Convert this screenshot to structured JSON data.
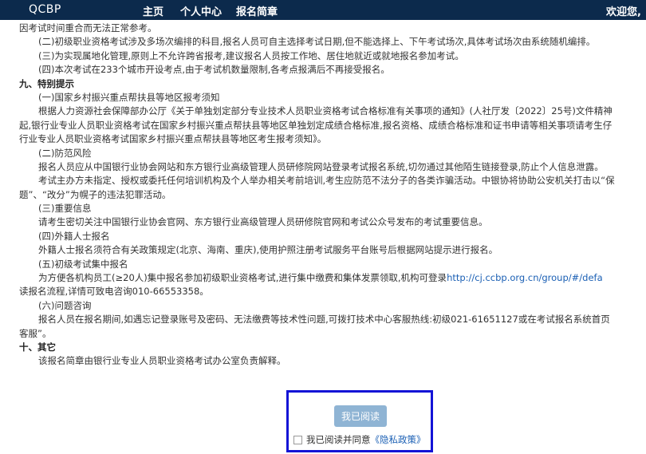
{
  "header": {
    "brand": "QCBP",
    "nav": [
      "主页",
      "个人中心",
      "报名简章"
    ],
    "welcome": "欢迎您,"
  },
  "lines": [
    {
      "style": "ind0",
      "text": "因考试时间重合而无法正常参考。"
    },
    {
      "style": "ind1",
      "text": "(二)初级职业资格考试涉及多场次编排的科目,报名人员可自主选择考试日期,但不能选择上、下午考试场次,具体考试场次由系统随机编排。"
    },
    {
      "style": "ind1",
      "text": "(三)为实现属地化管理,原则上不允许跨省报考,建议报名人员按工作地、居住地就近或就地报名参加考试。"
    },
    {
      "style": "ind1",
      "text": "(四)本次考试在233个城市开设考点,由于考试机数量限制,各考点报满后不再接受报名。"
    },
    {
      "style": "sec",
      "text": "九、特别提示"
    },
    {
      "style": "ind1",
      "text": "(一)国家乡村振兴重点帮扶县等地区报考须知"
    },
    {
      "style": "ind1",
      "text": "根据人力资源社会保障部办公厅《关于单独划定部分专业技术人员职业资格考试合格标准有关事项的通知》(人社厅发〔2022〕25号)文件精神"
    },
    {
      "style": "ind0",
      "text": "起,银行业专业人员职业资格考试在国家乡村振兴重点帮扶县等地区单独划定成绩合格标准,报名资格、成绩合格标准和证书申请等相关事项请考生仔"
    },
    {
      "style": "ind0",
      "text": "行业专业人员职业资格考试国家乡村振兴重点帮扶县等地区考生报考须知》。"
    },
    {
      "style": "ind1",
      "text": "(二)防范风险"
    },
    {
      "style": "ind1",
      "text": "报名人员应从中国银行业协会网站和东方银行业高级管理人员研修院网站登录考试报名系统,切勿通过其他陌生链接登录,防止个人信息泄露。"
    },
    {
      "style": "ind1",
      "text": "考试主办方未指定、授权或委托任何培训机构及个人举办相关考前培训,考生应防范不法分子的各类诈骗活动。中银协将协助公安机关打击以“保"
    },
    {
      "style": "ind0",
      "text": "题”、“改分”为幌子的违法犯罪活动。"
    },
    {
      "style": "ind1",
      "text": "(三)重要信息"
    },
    {
      "style": "ind1",
      "text": "请考生密切关注中国银行业协会官网、东方银行业高级管理人员研修院官网和考试公众号发布的考试重要信息。"
    },
    {
      "style": "ind1",
      "text": "(四)外籍人士报名"
    },
    {
      "style": "ind1",
      "text": "外籍人士报名须符合有关政策规定(北京、海南、重庆),使用护照注册考试服务平台账号后根据网站提示进行报名。"
    },
    {
      "style": "ind1",
      "text": "(五)初级考试集中报名"
    },
    {
      "style": "ind1",
      "text": "为方便各机构员工(≥20人)集中报名参加初级职业资格考试,进行集中缴费和集体发票领取,机构可登录",
      "link": "http://cj.ccbp.org.cn/group/#/defa"
    },
    {
      "style": "ind0",
      "text": "读报名流程,详情可致电咨询010-66553358。"
    },
    {
      "style": "ind1",
      "text": "(六)问题咨询"
    },
    {
      "style": "ind1",
      "text": "报名人员在报名期间,如遇忘记登录账号及密码、无法缴费等技术性问题,可拨打技术中心客服热线:初级021-61651127或在考试报名系统首页"
    },
    {
      "style": "ind0",
      "text": "客服”。"
    },
    {
      "style": "sec",
      "text": "十、其它"
    },
    {
      "style": "ind1",
      "text": "该报名简章由银行业专业人员职业资格考试办公室负责解释。"
    }
  ],
  "footer": {
    "read_button": "我已阅读",
    "agree_text": "我已阅读并同意",
    "privacy_link": "《隐私政策》",
    "box_color": "#1414d6",
    "button_color": "#8fb4d4"
  }
}
